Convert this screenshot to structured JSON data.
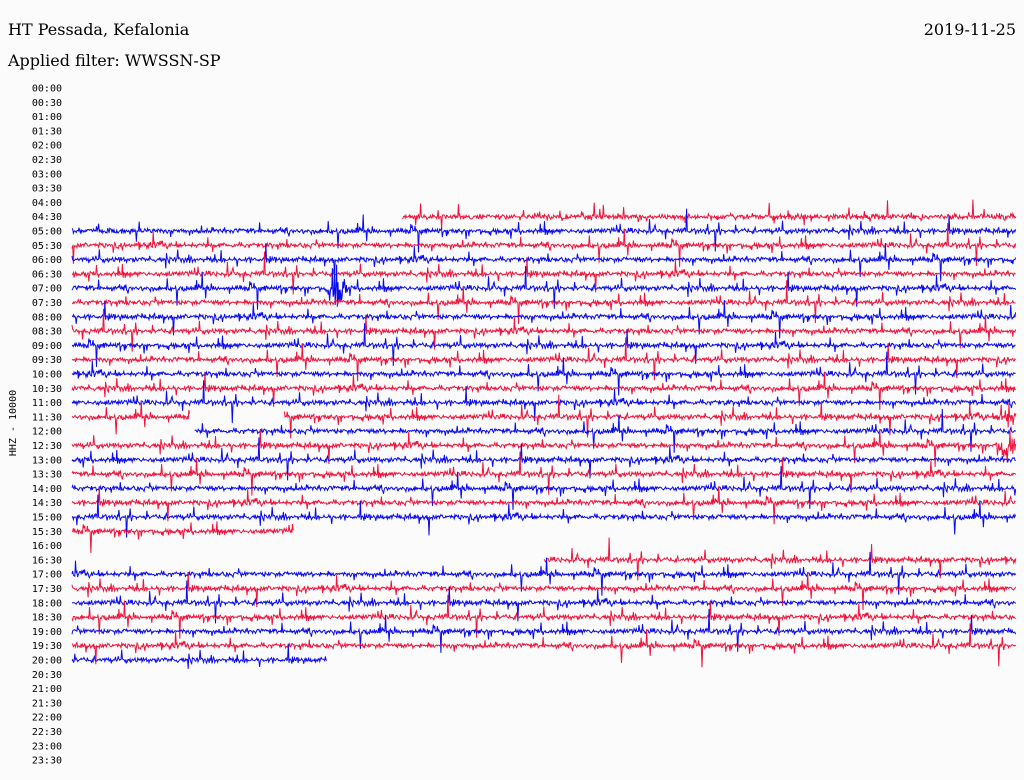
{
  "header": {
    "station": "HT Pessada, Kefalonia",
    "date": "2019-11-25",
    "filter": "Applied filter: WWSSN-SP"
  },
  "colors": {
    "blue": "#0a0af0",
    "red": "#f0143c"
  },
  "chart_data": {
    "type": "line",
    "title": "HT Pessada, Kefalonia",
    "ylabel": "HHZ - 10000",
    "rows": [
      "00:00",
      "00:30",
      "01:00",
      "01:30",
      "02:00",
      "02:30",
      "03:00",
      "03:30",
      "04:00",
      "04:30",
      "05:00",
      "05:30",
      "06:00",
      "06:30",
      "07:00",
      "07:30",
      "08:00",
      "08:30",
      "09:00",
      "09:30",
      "10:00",
      "10:30",
      "11:00",
      "11:30",
      "12:00",
      "12:30",
      "13:00",
      "13:30",
      "14:00",
      "14:30",
      "15:00",
      "15:30",
      "16:00",
      "16:30",
      "17:00",
      "17:30",
      "18:00",
      "18:30",
      "19:00",
      "19:30",
      "20:00",
      "20:30",
      "21:00",
      "21:30",
      "22:00",
      "22:30",
      "23:00",
      "23:30"
    ],
    "row_minutes": 30,
    "traces": [
      {
        "row": "04:30",
        "color": "red",
        "start": 0.35,
        "end": 1.0
      },
      {
        "row": "05:00",
        "color": "blue",
        "start": 0,
        "end": 1.0
      },
      {
        "row": "05:30",
        "color": "red",
        "start": 0,
        "end": 1.0
      },
      {
        "row": "06:00",
        "color": "blue",
        "start": 0,
        "end": 1.0
      },
      {
        "row": "06:30",
        "color": "red",
        "start": 0,
        "end": 1.0
      },
      {
        "row": "07:00",
        "color": "blue",
        "start": 0,
        "end": 1.0
      },
      {
        "row": "07:30",
        "color": "red",
        "start": 0,
        "end": 1.0
      },
      {
        "row": "08:00",
        "color": "blue",
        "start": 0,
        "end": 1.0
      },
      {
        "row": "08:30",
        "color": "red",
        "start": 0,
        "end": 1.0
      },
      {
        "row": "09:00",
        "color": "blue",
        "start": 0,
        "end": 1.0
      },
      {
        "row": "09:30",
        "color": "red",
        "start": 0,
        "end": 1.0
      },
      {
        "row": "10:00",
        "color": "blue",
        "start": 0,
        "end": 1.0
      },
      {
        "row": "10:30",
        "color": "red",
        "start": 0,
        "end": 1.0
      },
      {
        "row": "11:00",
        "color": "blue",
        "start": 0,
        "end": 1.0
      },
      {
        "row": "11:30",
        "color": "red",
        "start": 0,
        "end": 1.0,
        "gaps": [
          [
            0.125,
            0.225
          ]
        ]
      },
      {
        "row": "12:00",
        "color": "blue",
        "start": 0,
        "end": 1.0,
        "gaps": [
          [
            0.0,
            0.13
          ]
        ]
      },
      {
        "row": "12:30",
        "color": "red",
        "start": 0,
        "end": 1.0
      },
      {
        "row": "13:00",
        "color": "blue",
        "start": 0,
        "end": 1.0
      },
      {
        "row": "13:30",
        "color": "red",
        "start": 0,
        "end": 1.0
      },
      {
        "row": "14:00",
        "color": "blue",
        "start": 0,
        "end": 1.0
      },
      {
        "row": "14:30",
        "color": "red",
        "start": 0,
        "end": 1.0
      },
      {
        "row": "15:00",
        "color": "blue",
        "start": 0,
        "end": 1.0
      },
      {
        "row": "15:30",
        "color": "red",
        "start": 0,
        "end": 0.235
      },
      {
        "row": "16:30",
        "color": "red",
        "start": 0.5,
        "end": 1.0
      },
      {
        "row": "17:00",
        "color": "blue",
        "start": 0,
        "end": 1.0
      },
      {
        "row": "17:30",
        "color": "red",
        "start": 0,
        "end": 1.0
      },
      {
        "row": "18:00",
        "color": "blue",
        "start": 0,
        "end": 1.0
      },
      {
        "row": "18:30",
        "color": "red",
        "start": 0,
        "end": 1.0
      },
      {
        "row": "19:00",
        "color": "blue",
        "start": 0,
        "end": 1.0
      },
      {
        "row": "19:30",
        "color": "red",
        "start": 0,
        "end": 1.0
      },
      {
        "row": "20:00",
        "color": "blue",
        "start": 0,
        "end": 0.27
      }
    ],
    "events": [
      {
        "row": "07:00",
        "at": 0.28,
        "color": "blue",
        "strength": 3.2
      },
      {
        "row": "12:30",
        "at": 0.99,
        "color": "red",
        "strength": 2.2
      },
      {
        "row": "11:30",
        "at": 0.99,
        "color": "red",
        "strength": 1.8
      }
    ]
  }
}
